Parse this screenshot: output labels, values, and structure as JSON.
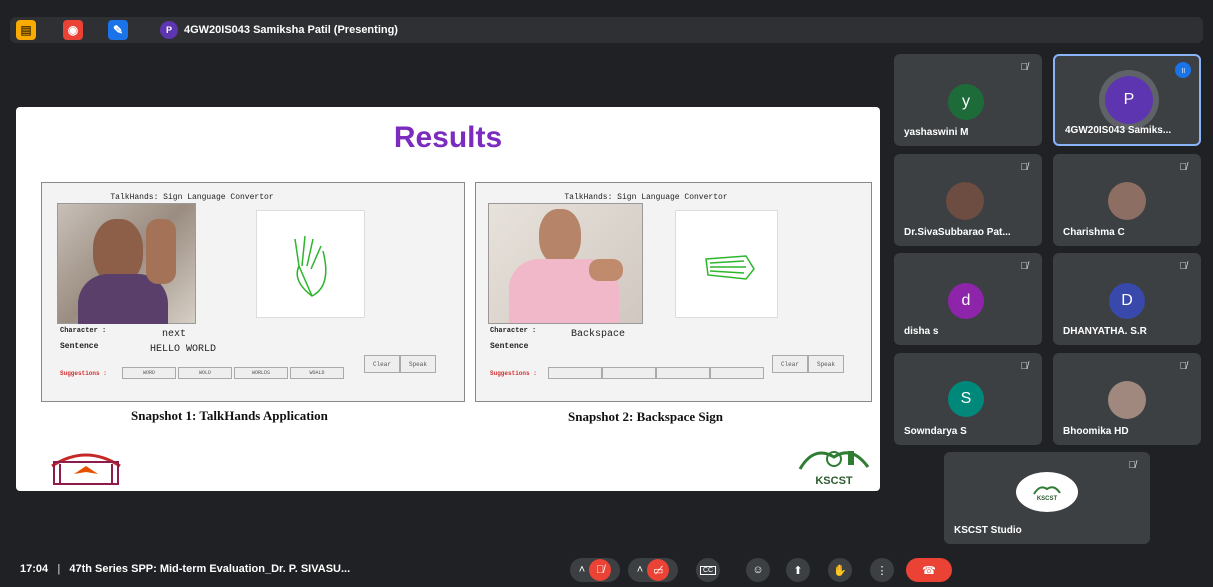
{
  "topbar": {
    "presenter_initial": "P",
    "presenter_label": "4GW20IS043 Samiksha Patil (Presenting)"
  },
  "slide": {
    "title": "Results",
    "snapshot1": {
      "window_title": "TalkHands: Sign Language Convertor",
      "character_label": "Character :",
      "character_value": "next",
      "sentence_label": "Sentence",
      "sentence_value": "HELLO WORLD",
      "suggestions_label": "Suggestions :",
      "suggestions": [
        "WORD",
        "WOLD",
        "WORLDS",
        "WOALD"
      ],
      "clear_label": "Clear",
      "speak_label": "Speak",
      "caption": "Snapshot 1: TalkHands Application"
    },
    "snapshot2": {
      "window_title": "TalkHands: Sign Language Convertor",
      "character_label": "Character :",
      "character_value": "Backspace",
      "sentence_label": "Sentence",
      "suggestions_label": "Suggestions :",
      "clear_label": "Clear",
      "speak_label": "Speak",
      "caption": "Snapshot 2: Backspace Sign"
    },
    "logo_right_text": "KSCST"
  },
  "participants": [
    {
      "name": "yashaswini M",
      "initial": "y",
      "color": "#1e6b3a"
    },
    {
      "name": "4GW20IS043 Samiks...",
      "initial": "P",
      "color": "#5e35b1"
    },
    {
      "name": "Dr.SivaSubbarao Pat...",
      "initial": "",
      "color": "#6d4c41"
    },
    {
      "name": "Charishma C",
      "initial": "",
      "color": "#8d6e63"
    },
    {
      "name": "disha s",
      "initial": "d",
      "color": "#8e24aa"
    },
    {
      "name": "DHANYATHA. S.R",
      "initial": "D",
      "color": "#3949ab"
    },
    {
      "name": "Sowndarya S",
      "initial": "S",
      "color": "#00897b"
    },
    {
      "name": "Bhoomika HD",
      "initial": "",
      "color": "#a1887f"
    },
    {
      "name": "KSCST Studio",
      "initial": "",
      "color": "#ffffff"
    }
  ],
  "studio_logo_text": "KSCST",
  "bottom": {
    "time": "17:04",
    "separator": "|",
    "meeting_title": "47th Series SPP: Mid-term Evaluation_Dr. P. SIVASU..."
  },
  "colors": {
    "accent_red": "#ea4335",
    "title_purple": "#7b2cbf",
    "tile_bg": "#3c4043"
  }
}
